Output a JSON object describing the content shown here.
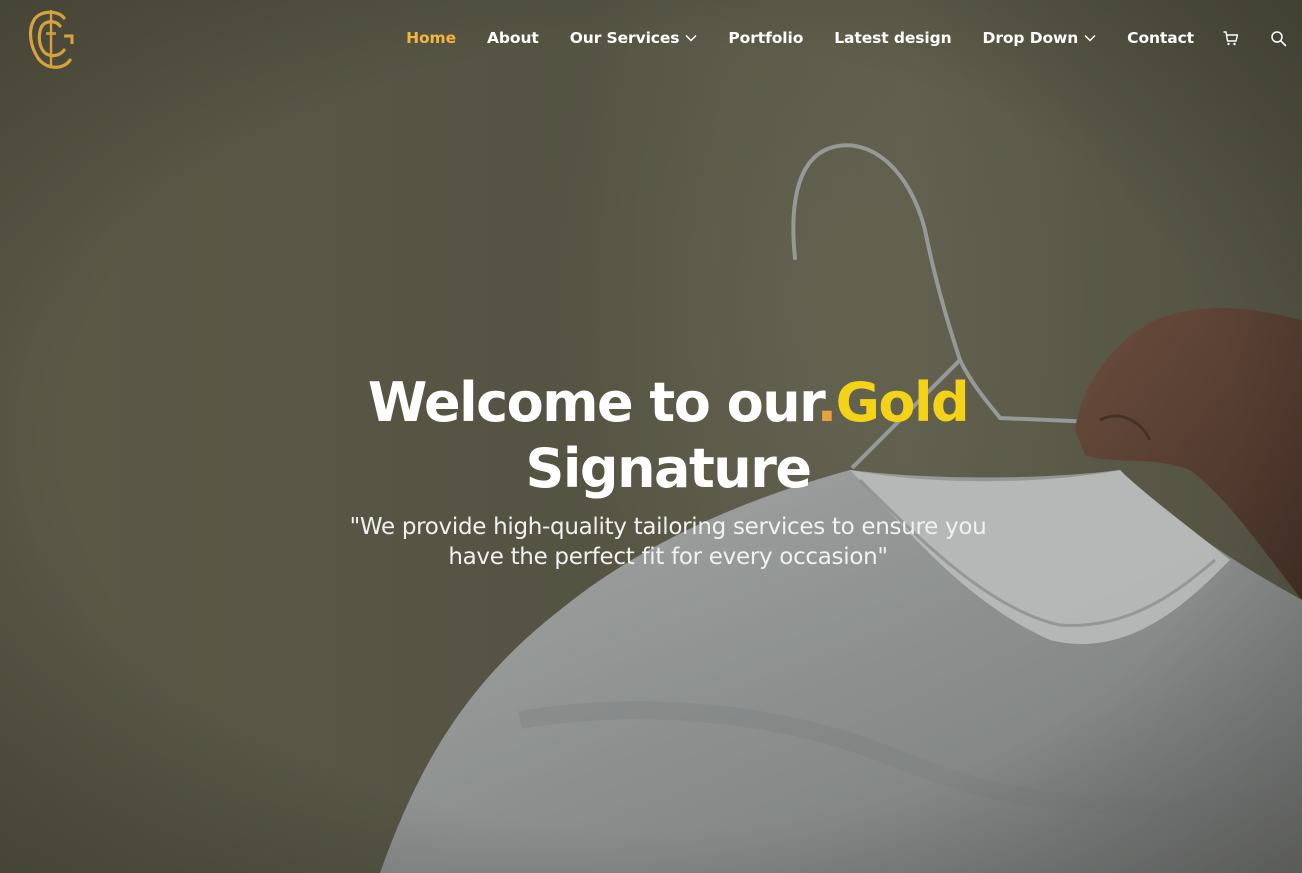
{
  "brand": {
    "accent_color": "#f2b740",
    "highlight_color": "#f4d218",
    "logo_icon": "tailor-monogram-logo"
  },
  "nav": {
    "items": [
      {
        "label": "Home",
        "active": true
      },
      {
        "label": "About"
      },
      {
        "label": "Our Services",
        "dropdown": true
      },
      {
        "label": "Portfolio"
      },
      {
        "label": "Latest design"
      },
      {
        "label": "Drop Down",
        "dropdown": true
      },
      {
        "label": "Contact"
      }
    ],
    "cart_icon": "cart-icon",
    "search_icon": "search-icon"
  },
  "hero": {
    "title_part1": "Welcome to our",
    "title_dot": ".",
    "title_highlight": "Gold",
    "title_part2": "Signature",
    "subtitle": "\"We provide high-quality tailoring services to ensure you have the perfect fit for every occasion\""
  }
}
